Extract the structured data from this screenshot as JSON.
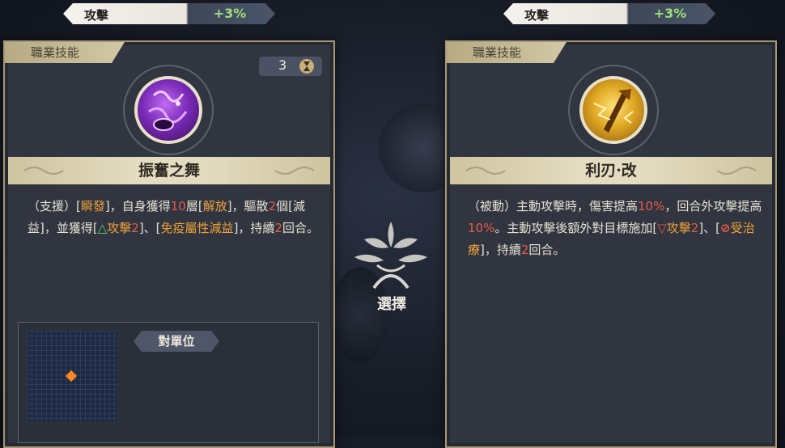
{
  "top_stats": [
    {
      "label": "攻擊",
      "value": "+3%"
    },
    {
      "label": "攻擊",
      "value": "+3%"
    }
  ],
  "left_card": {
    "tab": "職業技能",
    "counter": "3",
    "skill_name": "振奮之舞",
    "desc": {
      "p1": "（支援）[",
      "k1": "瞬發",
      "p2": "]，自身獲得",
      "n1": "10",
      "p3": "層[",
      "k2": "解放",
      "p4": "]，驅散",
      "n2": "2",
      "p5": "個[減益]，並獲得[",
      "icon1": "△",
      "k3": "攻擊",
      "n3": "2",
      "p6": "]、[",
      "k4": "免疫屬性減益",
      "p7": "]，持續",
      "n4": "2",
      "p8": "回合。"
    },
    "target_label": "對單位"
  },
  "center": {
    "select_label": "選擇"
  },
  "right_card": {
    "tab": "職業技能",
    "skill_name": "利刃·改",
    "desc": {
      "p1": "（被動）主動攻擊時，傷害提高",
      "n1": "10%",
      "p2": "，回合外攻擊提高",
      "n2": "10%",
      "p3": "。主動攻擊後額外對目標施加[",
      "icon1": "▽",
      "k1": "攻擊",
      "n3": "2",
      "p4": "]、[",
      "icon2": "⊘",
      "k2": "受治療",
      "p5": "]，持續",
      "n4": "2",
      "p6": "回合。"
    }
  },
  "colors": {
    "accent_gold": "#d2c8a4",
    "highlight_orange": "#f0a23b",
    "number_red": "#e85a4a",
    "stat_green": "#9be07a"
  },
  "icons": {
    "counter_icon": "hourglass-icon",
    "left_skill": "purple-dance-skill-icon",
    "right_skill": "golden-blade-skill-icon",
    "select_emblem": "leaf-tree-emblem-icon"
  }
}
